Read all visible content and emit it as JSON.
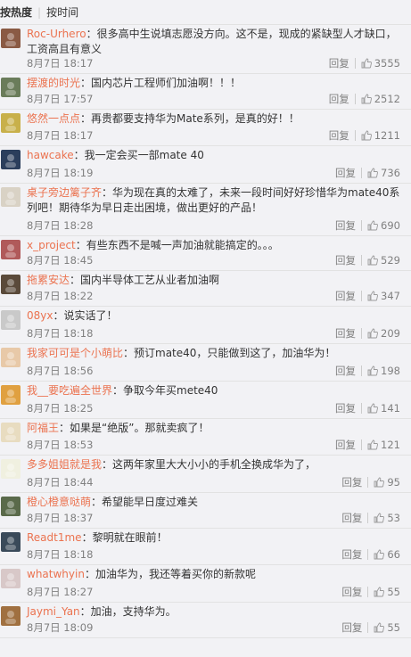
{
  "sort": {
    "hot": "按热度",
    "separator": "|",
    "time": "按时间"
  },
  "actions": {
    "reply": "回复"
  },
  "comments": [
    {
      "user": "Roc-Urhero",
      "text": "：很多高中生说填志愿没方向。这不是，现成的紧缺型人才缺口，工资高且有意义",
      "date": "8月7日",
      "time": "18:17",
      "likes": "3555",
      "avatar_color": "#8a5a44"
    },
    {
      "user": "摆渡的时光",
      "text": "：国内芯片工程师们加油啊！！！",
      "date": "8月7日",
      "time": "17:57",
      "likes": "2512",
      "avatar_color": "#6a7c5a"
    },
    {
      "user": "悠然一点点",
      "text": "：再贵都要支持华为Mate系列，是真的好！！",
      "date": "8月7日",
      "time": "18:17",
      "likes": "1211",
      "avatar_color": "#c8b04a"
    },
    {
      "user": "hawcake",
      "text": "：我一定会买一部mate 40",
      "date": "8月7日",
      "time": "18:19",
      "likes": "736",
      "avatar_color": "#2b3e5c"
    },
    {
      "user": "桌子旁边篱子齐",
      "text": "：华为现在真的太难了，未来一段时间好好珍惜华为mate40系列吧！期待华为早日走出困境，做出更好的产品！",
      "date": "8月7日",
      "time": "18:28",
      "likes": "690",
      "avatar_color": "#d9d2c5"
    },
    {
      "user": "x_project",
      "text": "：有些东西不是喊一声加油就能搞定的。。。",
      "date": "8月7日",
      "time": "18:45",
      "likes": "529",
      "avatar_color": "#b05a5a"
    },
    {
      "user": "拖累安达",
      "text": "：国内半导体工艺从业者加油啊",
      "date": "8月7日",
      "time": "18:22",
      "likes": "347",
      "avatar_color": "#5a4a3a"
    },
    {
      "user": "08yx",
      "text": "：说实话了！",
      "date": "8月7日",
      "time": "18:18",
      "likes": "209",
      "avatar_color": "#c9c9c9"
    },
    {
      "user": "我家可可是个小萌比",
      "text": "：预订mate40，只能做到这了，加油华为！",
      "date": "8月7日",
      "time": "18:56",
      "likes": "198",
      "avatar_color": "#e8c9a8"
    },
    {
      "user": "我__要吃遍全世界",
      "text": "：争取今年买mete40",
      "date": "8月7日",
      "time": "18:25",
      "likes": "141",
      "avatar_color": "#e0a040"
    },
    {
      "user": "阿福王",
      "text": "：如果是“绝版”。那就卖疯了！",
      "date": "8月7日",
      "time": "18:53",
      "likes": "121",
      "avatar_color": "#e8dcc0"
    },
    {
      "user": "多多姐姐就是我",
      "text": "：这两年家里大大小小的手机全换成华为了，",
      "date": "8月7日",
      "time": "18:44",
      "likes": "95",
      "avatar_color": "#f0f0e0"
    },
    {
      "user": "橙心橙意哒萌",
      "text": "：希望能早日度过难关",
      "date": "8月7日",
      "time": "18:37",
      "likes": "53",
      "avatar_color": "#5a6a4a"
    },
    {
      "user": "Readt1me",
      "text": "：黎明就在眼前！",
      "date": "8月7日",
      "time": "18:18",
      "likes": "66",
      "avatar_color": "#3a4a5a"
    },
    {
      "user": "whatwhyin",
      "text": "：加油华为，我还等着买你的新款呢",
      "date": "8月7日",
      "time": "18:27",
      "likes": "55",
      "avatar_color": "#d8c8c8"
    },
    {
      "user": "Jaymi_Yan",
      "text": "：加油，支持华为。",
      "date": "8月7日",
      "time": "18:09",
      "likes": "55",
      "avatar_color": "#a07040"
    }
  ]
}
